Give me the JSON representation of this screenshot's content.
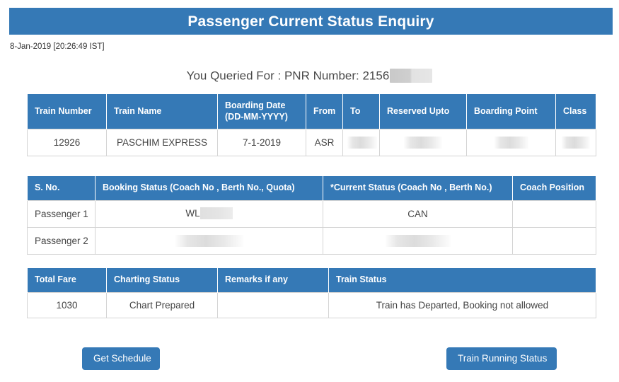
{
  "banner": {
    "title": "Passenger Current Status Enquiry"
  },
  "timestamp": "8-Jan-2019 [20:26:49 IST]",
  "query": {
    "text": "You Queried For : PNR Number: 2156",
    "redacted": true
  },
  "journey_table": {
    "headers": [
      "Train Number",
      "Train Name",
      "Boarding Date (DD-MM-YYYY)",
      "From",
      "To",
      "Reserved Upto",
      "Boarding Point",
      "Class"
    ],
    "rows": [
      {
        "train_number": "12926",
        "train_name": "PASCHIM EXPRESS",
        "boarding_date": "7-1-2019",
        "from": "ASR",
        "to": "",
        "reserved_upto": "",
        "boarding_point": "",
        "class": ""
      }
    ]
  },
  "passenger_table": {
    "headers": [
      "S. No.",
      "Booking Status (Coach No , Berth No., Quota)",
      "*Current Status (Coach No , Berth No.)",
      "Coach Position"
    ],
    "rows": [
      {
        "serial": "Passenger 1",
        "booking_status": "WL",
        "current_status": "CAN",
        "coach_position": ""
      },
      {
        "serial": "Passenger 2",
        "booking_status": "",
        "current_status": "",
        "coach_position": ""
      }
    ]
  },
  "summary_table": {
    "headers": [
      "Total Fare",
      "Charting Status",
      "Remarks if any",
      "Train Status"
    ],
    "rows": [
      {
        "total_fare": "1030",
        "charting_status": "Chart Prepared",
        "remarks": "",
        "train_status": "Train has Departed, Booking not allowed"
      }
    ]
  },
  "buttons": {
    "get_schedule": "Get Schedule",
    "train_running_status": "Train Running Status"
  },
  "colors": {
    "brand_blue": "#3579b6",
    "header_text": "#ffffff",
    "body_text": "#444444",
    "border": "#d4d4d4",
    "redaction": "#e0e0e0"
  }
}
